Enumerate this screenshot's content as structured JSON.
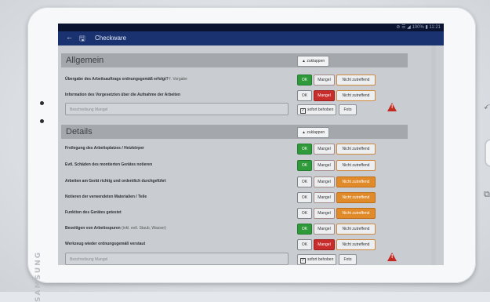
{
  "device": {
    "brand": "SAMSUNG"
  },
  "statusbar": {
    "text": "⊘ ☰ ◢ 100% ▮ 11:21"
  },
  "appbar": {
    "back_icon": "back-arrow-icon",
    "save_icon": "save-icon",
    "title": "Checkware"
  },
  "sections": [
    {
      "title": "Allgemein",
      "collapse_label": "▲ zuklappen",
      "rows": [
        {
          "label": "Übergabe des Arbeitsauftrags ordnungsgemäß erfolgt?",
          "sub": "f. Vorgabe",
          "ok": "OK",
          "mangel": "Mangel",
          "nz": "Nicht zutreffend",
          "state": "ok"
        },
        {
          "label": "Information des Vorgesetzten über die Aufnahme der Arbeiten",
          "sub": "",
          "ok": "OK",
          "mangel": "Mangel",
          "nz": "Nicht zutreffend",
          "state": "mangel"
        }
      ],
      "desc": {
        "placeholder": "Beschreibung Mangel",
        "sofort_label": "sofort behoben",
        "foto_label": "Foto",
        "warn_mark": "!"
      }
    },
    {
      "title": "Details",
      "collapse_label": "▲ zuklappen",
      "rows": [
        {
          "label": "Freilegung des Arbeitsplatzes / Heizkörper",
          "sub": "",
          "ok": "OK",
          "mangel": "Mangel",
          "nz": "Nicht zutreffend",
          "state": "ok"
        },
        {
          "label": "Evtl. Schäden des montierten Gerätes notieren",
          "sub": "",
          "ok": "OK",
          "mangel": "Mangel",
          "nz": "Nicht zutreffend",
          "state": "ok"
        },
        {
          "label": "Arbeiten am Gerät richtig und ordentlich durchgeführt",
          "sub": "",
          "ok": "OK",
          "mangel": "Mangel",
          "nz": "Nicht zutreffend",
          "state": "nz"
        },
        {
          "label": "Notieren der verwendeten Materialien / Teile",
          "sub": "",
          "ok": "OK",
          "mangel": "Mangel",
          "nz": "Nicht zutreffend",
          "state": "nz"
        },
        {
          "label": "Funktion des Gerätes getestet",
          "sub": "",
          "ok": "OK",
          "mangel": "Mangel",
          "nz": "Nicht zutreffend",
          "state": "nz"
        },
        {
          "label": "Beseitigen von Arbeitsspuren",
          "sub": "(inkl. evtl. Staub, Wasser)",
          "ok": "OK",
          "mangel": "Mangel",
          "nz": "Nicht zutreffend",
          "state": "ok"
        },
        {
          "label": "Werkzeug wieder ordnungsgemäß verstaut",
          "sub": "",
          "ok": "OK",
          "mangel": "Mangel",
          "nz": "Nicht zutreffend",
          "state": "mangel"
        }
      ],
      "desc": {
        "placeholder": "Beschreibung Mangel",
        "sofort_label": "sofort behoben",
        "foto_label": "Foto",
        "warn_mark": "!"
      }
    }
  ],
  "colors": {
    "appbar": "#1a3270",
    "ok_active": "#2f9a3a",
    "mangel_active": "#c72e2b",
    "nz_active": "#e08a2a"
  }
}
